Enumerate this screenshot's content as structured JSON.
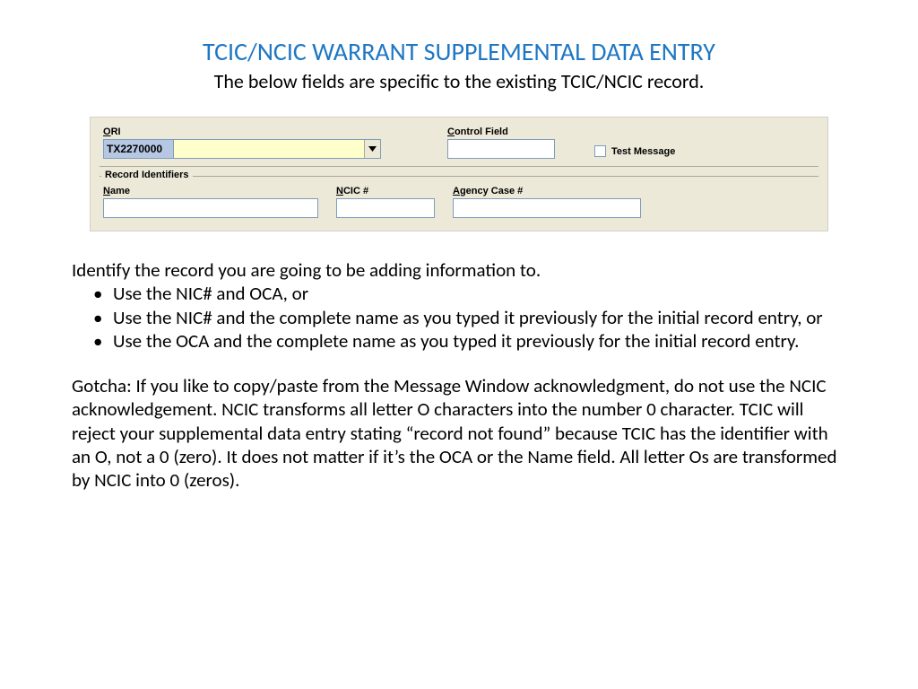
{
  "header": {
    "title": "TCIC/NCIC WARRANT SUPPLEMENTAL DATA ENTRY",
    "subtitle": "The below fields are specific to the existing TCIC/NCIC record."
  },
  "form": {
    "ori_label_u": "O",
    "ori_label_rest": "RI",
    "ori_value": "TX2270000",
    "control_label_u": "C",
    "control_label_rest": "ontrol Field",
    "control_value": "",
    "test_label": "Test Message",
    "record_identifiers_legend": "Record Identifiers",
    "name_label_u": "N",
    "name_label_rest": "ame",
    "name_value": "",
    "ncic_label_u": "N",
    "ncic_label_rest": "CIC #",
    "ncic_value": "",
    "agency_label_u": "A",
    "agency_label_rest": "gency Case #",
    "agency_value": ""
  },
  "body": {
    "intro": "Identify the record you are going to be adding information to.",
    "bullets": [
      "Use the NIC# and OCA, or",
      "Use the NIC# and the complete name as you typed it previously for the initial record entry, or",
      "Use the OCA and the complete name as you typed it previously for the initial record entry."
    ],
    "gotcha": "Gotcha:  If you like to copy/paste from the Message Window acknowledgment, do not use the NCIC acknowledgement.  NCIC transforms all letter O characters into the number 0 character.  TCIC will reject your supplemental data entry stating “record not found” because TCIC has the identifier with an O, not a 0 (zero).  It does not matter if it’s the OCA or the Name field. All letter Os are transformed by NCIC into 0 (zeros)."
  }
}
